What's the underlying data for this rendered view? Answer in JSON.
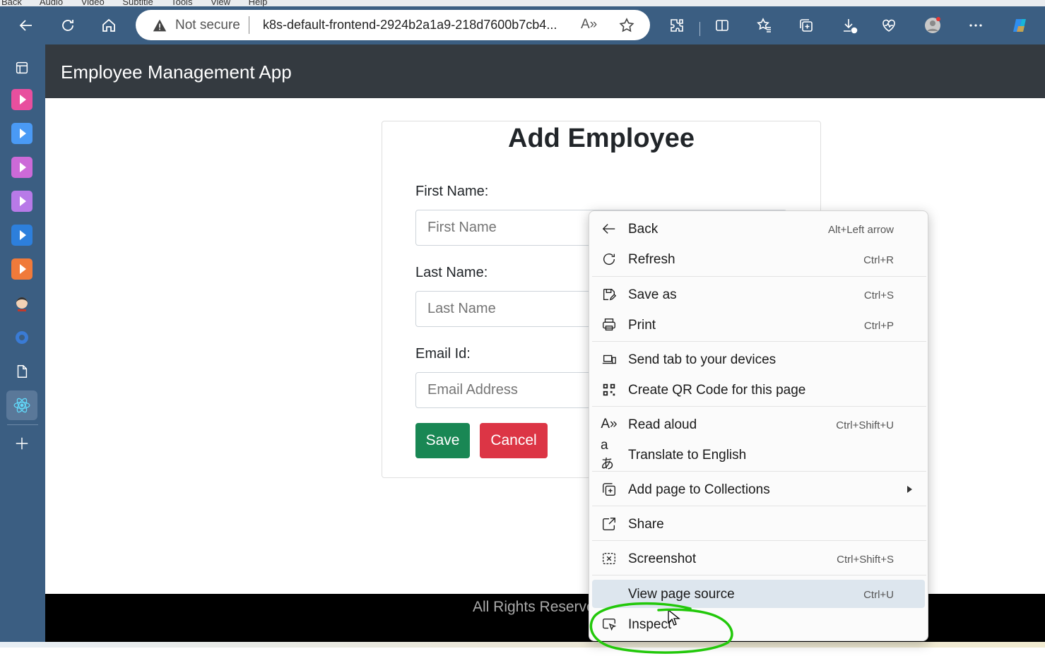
{
  "menu_bar": [
    "Back",
    "Audio",
    "Video",
    "Subtitle",
    "Tools",
    "View",
    "Help"
  ],
  "browser": {
    "security_label": "Not secure",
    "url": "k8s-default-frontend-2924b2a1a9-218d7600b7cb4...",
    "read_aloud_glyph": "A»"
  },
  "app": {
    "brand": "Employee Management App",
    "form": {
      "title": "Add Employee",
      "first_name_label": "First Name:",
      "first_name_placeholder": "First Name",
      "last_name_label": "Last Name:",
      "last_name_placeholder": "Last Name",
      "email_label": "Email Id:",
      "email_placeholder": "Email Address",
      "save_label": "Save",
      "cancel_label": "Cancel"
    },
    "footer": "All Rights Reserved"
  },
  "context_menu": {
    "items": [
      {
        "label": "Back",
        "shortcut": "Alt+Left arrow",
        "icon": "back-arrow-icon"
      },
      {
        "label": "Refresh",
        "shortcut": "Ctrl+R",
        "icon": "refresh-icon"
      },
      {
        "label": "Save as",
        "shortcut": "Ctrl+S",
        "icon": "save-as-icon"
      },
      {
        "label": "Print",
        "shortcut": "Ctrl+P",
        "icon": "print-icon"
      },
      {
        "label": "Send tab to your devices",
        "shortcut": "",
        "icon": "devices-icon"
      },
      {
        "label": "Create QR Code for this page",
        "shortcut": "",
        "icon": "qr-code-icon"
      },
      {
        "label": "Read aloud",
        "shortcut": "Ctrl+Shift+U",
        "icon": "read-aloud-icon"
      },
      {
        "label": "Translate to English",
        "shortcut": "",
        "icon": "translate-icon"
      },
      {
        "label": "Add page to Collections",
        "shortcut": "",
        "icon": "collections-icon"
      },
      {
        "label": "Share",
        "shortcut": "",
        "icon": "share-icon"
      },
      {
        "label": "Screenshot",
        "shortcut": "Ctrl+Shift+S",
        "icon": "screenshot-icon"
      },
      {
        "label": "View page source",
        "shortcut": "Ctrl+U",
        "icon": ""
      },
      {
        "label": "Inspect",
        "shortcut": "",
        "icon": "inspect-icon"
      }
    ],
    "glyphs": {
      "read_aloud": "A»",
      "translate": "aあ"
    }
  },
  "colors": {
    "toolbar": "#3b5e82",
    "navbar": "#343a40",
    "save": "#198754",
    "cancel": "#dc3545",
    "annotation": "#22c80a"
  }
}
